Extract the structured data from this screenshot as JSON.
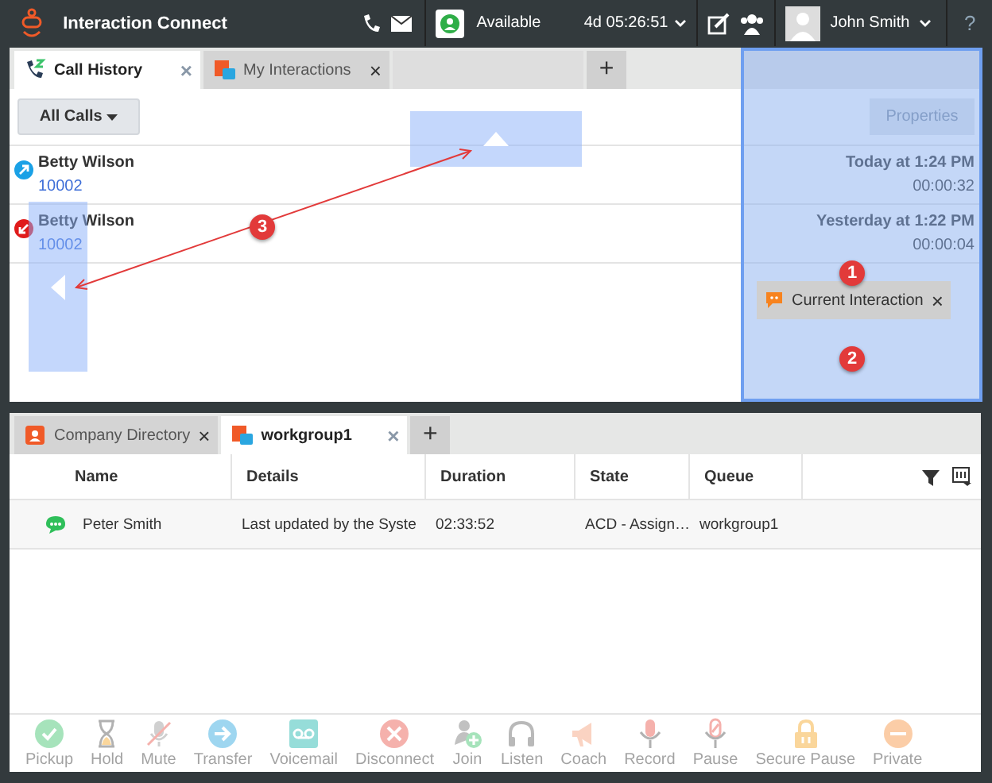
{
  "header": {
    "title": "Interaction Connect",
    "status": "Available",
    "timer": "4d 05:26:51",
    "user": "John Smith",
    "help": "?"
  },
  "top_panel": {
    "tabs": [
      {
        "label": "Call History",
        "selected": true,
        "kind": "history",
        "close": "×"
      },
      {
        "label": "My Interactions",
        "selected": false,
        "kind": "interactions",
        "close": "×"
      }
    ],
    "add_tab": "+",
    "filter": "All Calls",
    "properties": {
      "label": "Properties",
      "disabled": true
    },
    "calls": [
      {
        "name": "Betty Wilson",
        "number": "10002",
        "time": "Today at 1:24 PM",
        "duration": "00:00:32",
        "kind": "outgoing"
      },
      {
        "name": "Betty Wilson",
        "number": "10002",
        "time": "Yesterday at 1:22 PM",
        "duration": "00:00:04",
        "kind": "incoming"
      }
    ],
    "drop_chip": {
      "label": "Current Interaction",
      "close": "×"
    },
    "callouts": [
      "1",
      "2",
      "3"
    ]
  },
  "bottom_panel": {
    "tabs": [
      {
        "label": "Company Directory",
        "selected": false,
        "kind": "directory",
        "close": "×"
      },
      {
        "label": "workgroup1",
        "selected": true,
        "kind": "workgroup",
        "close": "×"
      }
    ],
    "add_tab": "+",
    "table": {
      "columns": [
        "Name",
        "Details",
        "Duration",
        "State",
        "Queue"
      ],
      "rows": [
        {
          "name": "Peter Smith",
          "details": "Last updated by the Syste",
          "duration": "02:33:52",
          "state": "ACD - Assign…",
          "queue": "workgroup1"
        }
      ]
    },
    "toolbar": [
      {
        "label": "Pickup",
        "kind": "pickup",
        "disabled": true
      },
      {
        "label": "Hold",
        "kind": "hold",
        "disabled": true
      },
      {
        "label": "Mute",
        "kind": "mute",
        "disabled": true
      },
      {
        "label": "Transfer",
        "kind": "transfer",
        "disabled": true
      },
      {
        "label": "Voicemail",
        "kind": "voicemail",
        "disabled": true
      },
      {
        "label": "Disconnect",
        "kind": "disconnect",
        "disabled": true
      },
      {
        "label": "Join",
        "kind": "join",
        "disabled": true
      },
      {
        "label": "Listen",
        "kind": "listen",
        "disabled": true
      },
      {
        "label": "Coach",
        "kind": "coach",
        "disabled": true
      },
      {
        "label": "Record",
        "kind": "record",
        "disabled": true
      },
      {
        "label": "Pause",
        "kind": "pause",
        "disabled": true
      },
      {
        "label": "Secure Pause",
        "kind": "secure-pause",
        "disabled": true
      },
      {
        "label": "Private",
        "kind": "private",
        "disabled": true
      }
    ]
  }
}
